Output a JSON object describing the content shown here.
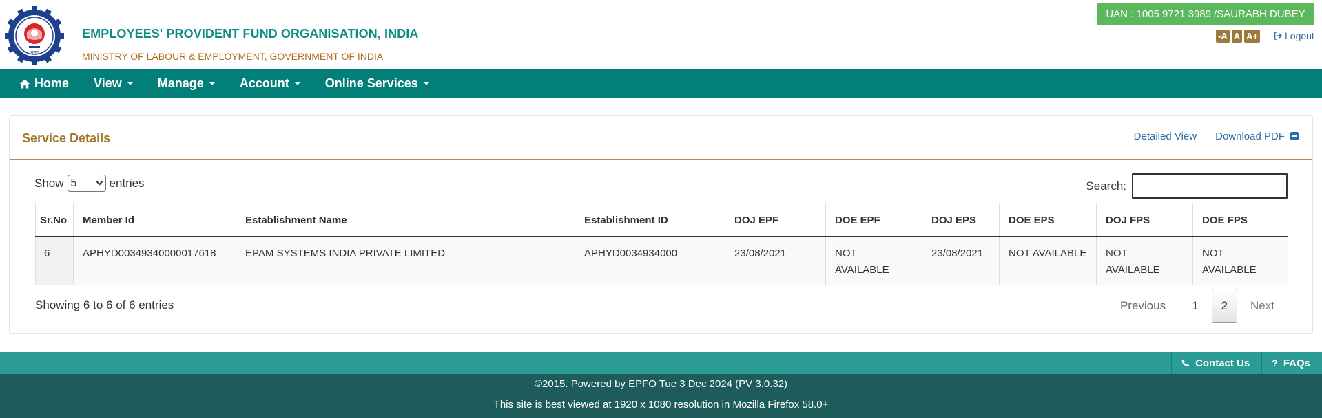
{
  "header": {
    "org_name": "EMPLOYEES' PROVIDENT FUND ORGANISATION, INDIA",
    "ministry": "MINISTRY OF LABOUR & EMPLOYMENT, GOVERNMENT OF INDIA",
    "uan_badge": "UAN : 1005 9721 3989 /SAURABH DUBEY",
    "font_decrease": "-A",
    "font_normal": "A",
    "font_increase": "A+",
    "logout_label": "Logout",
    "logo_icon": "epfo-logo-icon",
    "logo_text": "भारत"
  },
  "nav": {
    "home": "Home",
    "view": "View",
    "manage": "Manage",
    "account": "Account",
    "online_services": "Online Services"
  },
  "panel": {
    "title": "Service Details",
    "detailed_view": "Detailed View",
    "download_pdf": "Download PDF"
  },
  "table_controls": {
    "show_label": "Show",
    "entries_label": "entries",
    "length_value": "5",
    "search_label": "Search:",
    "search_value": ""
  },
  "table": {
    "headers": [
      "Sr.No",
      "Member Id",
      "Establishment Name",
      "Establishment ID",
      "DOJ EPF",
      "DOE EPF",
      "DOJ EPS",
      "DOE EPS",
      "DOJ FPS",
      "DOE FPS"
    ],
    "rows": [
      [
        "6",
        "APHYD00349340000017618",
        "EPAM SYSTEMS INDIA PRIVATE LIMITED",
        "APHYD0034934000",
        "23/08/2021",
        "NOT AVAILABLE",
        "23/08/2021",
        "NOT AVAILABLE",
        "NOT AVAILABLE",
        "NOT AVAILABLE"
      ]
    ]
  },
  "pagination": {
    "info": "Showing 6 to 6 of 6 entries",
    "previous": "Previous",
    "page1": "1",
    "page2": "2",
    "next": "Next"
  },
  "footer": {
    "contact_us": "Contact Us",
    "faqs": "FAQs",
    "line1": "©2015. Powered by EPFO Tue 3 Dec 2024 (PV 3.0.32)",
    "line2": "This site is best viewed at 1920 x 1080 resolution in Mozilla Firefox 58.0+"
  },
  "colors": {
    "nav_bg": "#037f7a",
    "uan_badge": "#5cb85c",
    "panel_title": "#a0772b",
    "link": "#2c6da8",
    "footer_dark": "#1d5c5a"
  }
}
